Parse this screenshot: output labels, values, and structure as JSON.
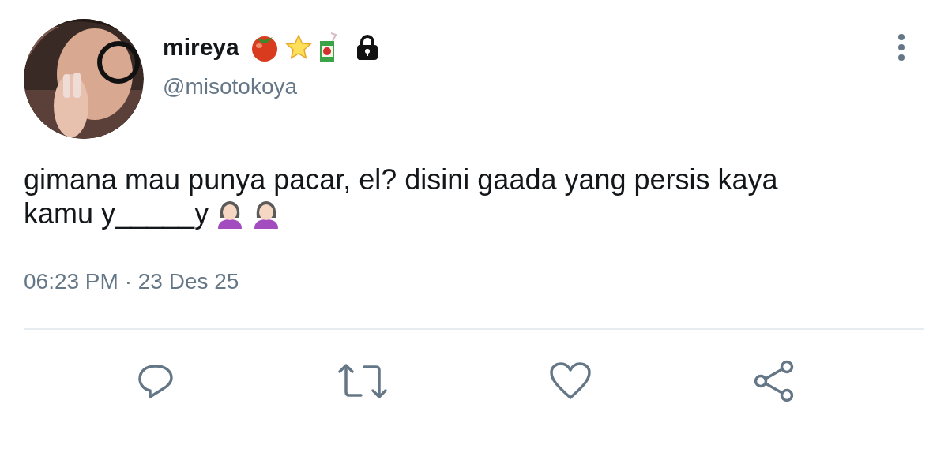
{
  "author": {
    "name": "mireya",
    "handle": "@misotokoya"
  },
  "tweet": {
    "lines": [
      "gimana mau punya pacar, el? disini gaada yang persis kaya",
      "kamu y_____y"
    ]
  },
  "timestamp": "06:23 PM · 23 Des 25"
}
